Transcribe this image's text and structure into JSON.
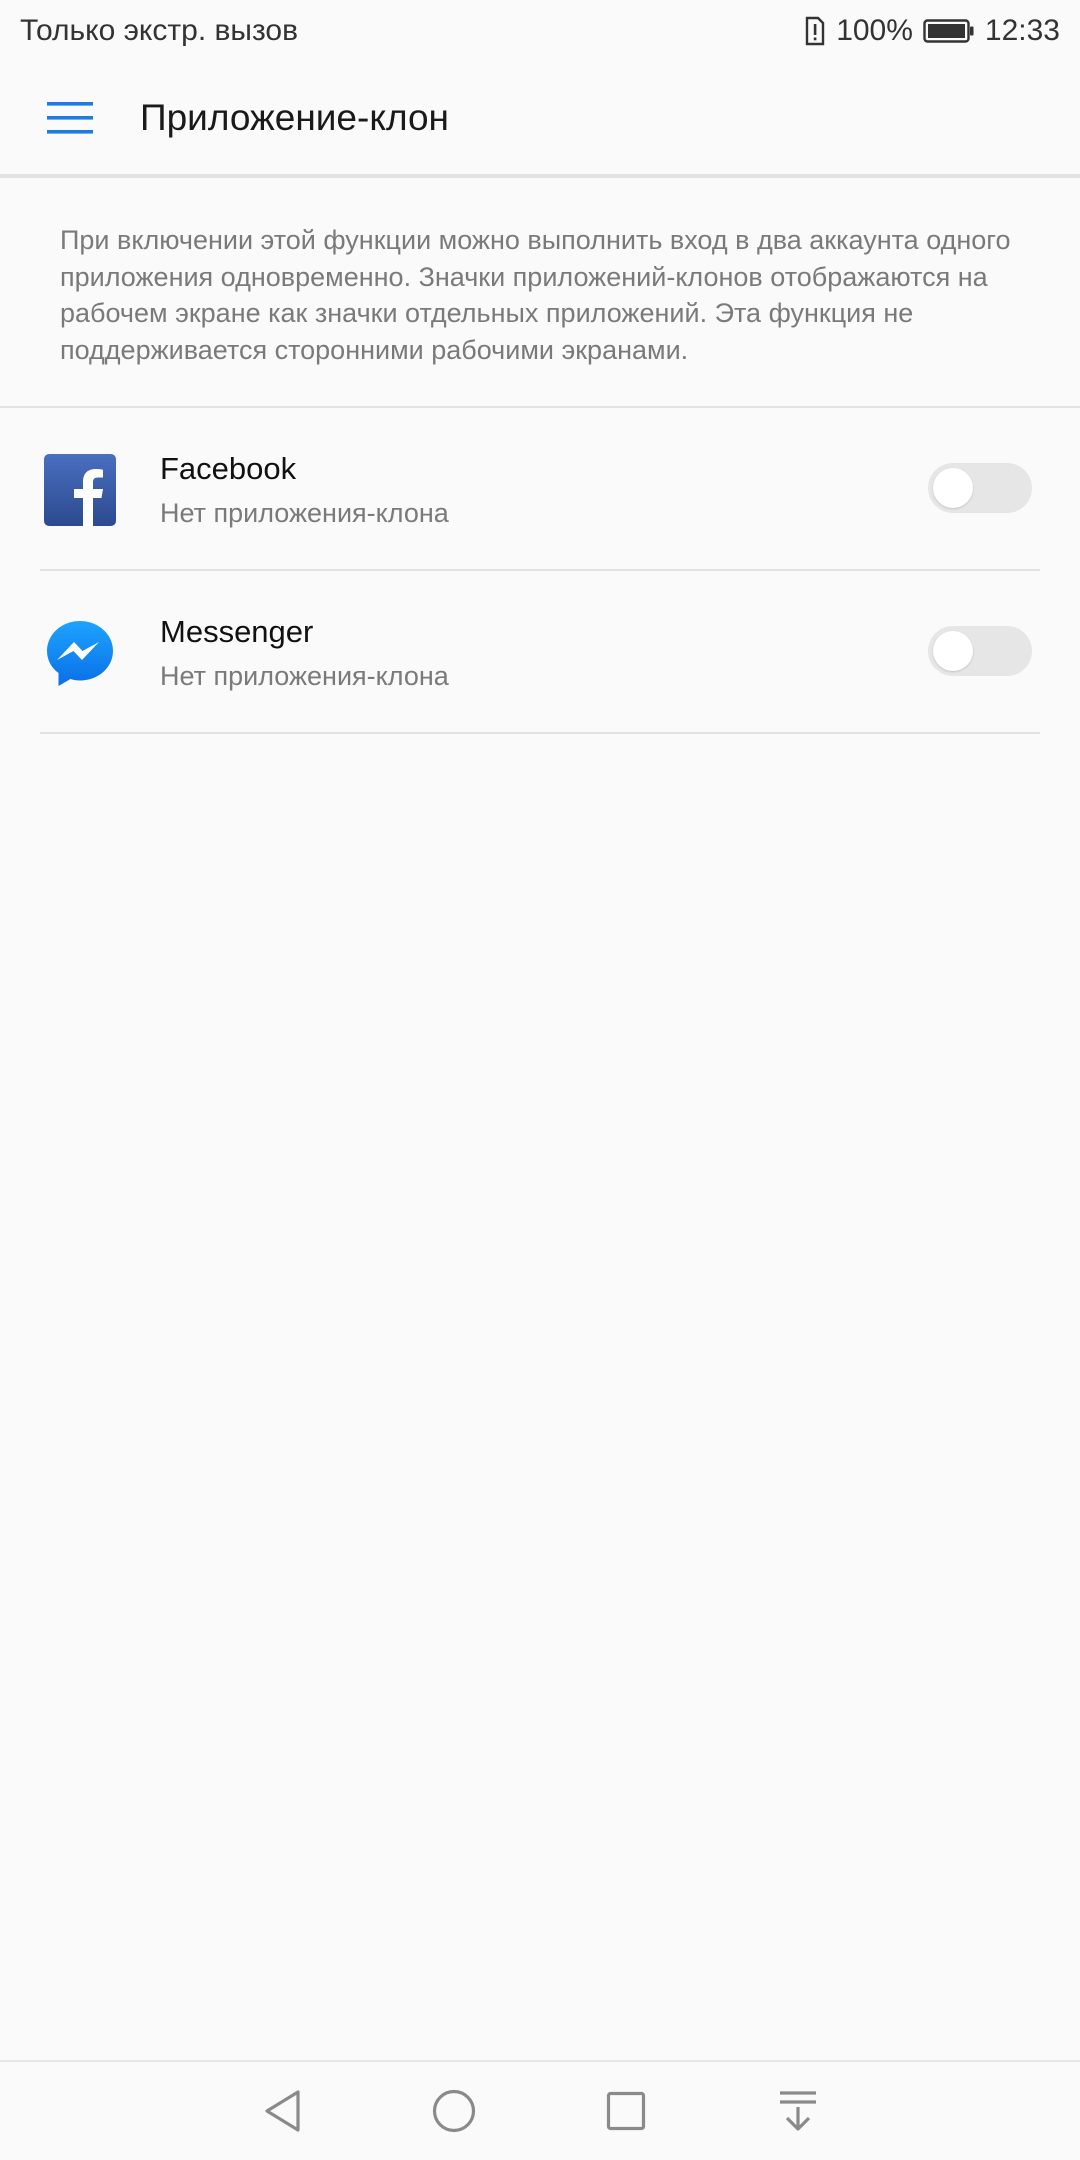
{
  "status_bar": {
    "carrier_text": "Только экстр. вызов",
    "battery_percent": "100%",
    "time": "12:33",
    "icons": [
      "sim-alert-icon",
      "battery-icon"
    ]
  },
  "app_bar": {
    "menu_icon": "hamburger-menu-icon",
    "title": "Приложение-клон",
    "accent_color": "#1e7ce0"
  },
  "description": "При включении этой функции можно выполнить вход в два аккаунта одного приложения одновременно. Значки приложений-клонов отображаются на рабочем экране как значки отдельных приложений. Эта функция не поддерживается сторонними рабочими экранами.",
  "apps": [
    {
      "name": "Facebook",
      "status": "Нет приложения-клона",
      "icon": "facebook-icon",
      "enabled": false
    },
    {
      "name": "Messenger",
      "status": "Нет приложения-клона",
      "icon": "messenger-icon",
      "enabled": false
    }
  ],
  "nav_bar": {
    "buttons": [
      "back-icon",
      "home-icon",
      "recents-icon",
      "notification-pull-icon"
    ]
  }
}
